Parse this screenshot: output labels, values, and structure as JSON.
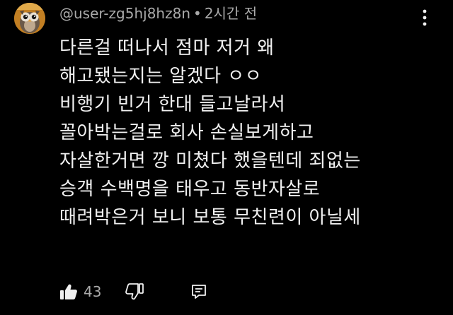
{
  "comment": {
    "username": "@user-zg5hj8hz8n",
    "separator": "•",
    "timestamp": "2시간 전",
    "lines": [
      "다른걸 떠나서 점마 저거 왜",
      "해고됐는지는 알겠다 ㅇㅇ",
      "비행기 빈거 한대 들고날라서",
      "꼴아박는걸로 회사 손실보게하고",
      "자살한거면 깡 미쳤다 했을텐데 죄없는",
      "승객 수백명을 태우고 동반자살로",
      "때려박은거 보니 보통 무친련이 아닐세"
    ],
    "like_count": "43"
  },
  "icons": {
    "avatar": "owl-avatar",
    "more": "more-vert-icon",
    "like": "thumb-up-icon",
    "dislike": "thumb-down-icon",
    "reply": "reply-icon"
  },
  "colors": {
    "background": "#000000",
    "text": "#f1f1f1",
    "secondary": "#aaaaaa"
  }
}
